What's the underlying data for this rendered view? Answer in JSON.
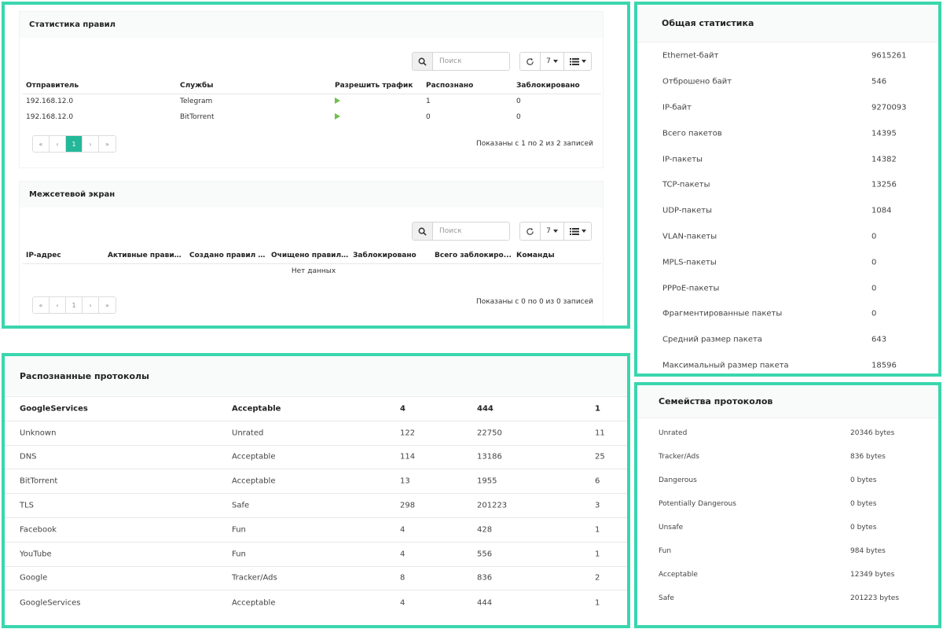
{
  "rules_stats": {
    "title": "Статистика правил",
    "search_placeholder": "Поиск",
    "page_size": "7",
    "columns": [
      "Отправитель",
      "Службы",
      "Разрешить трафик",
      "Распознано",
      "Заблокировано"
    ],
    "rows": [
      {
        "sender": "192.168.12.0",
        "service": "Telegram",
        "recognized": "1",
        "blocked": "0"
      },
      {
        "sender": "192.168.12.0",
        "service": "BitTorrent",
        "recognized": "0",
        "blocked": "0"
      }
    ],
    "pager": {
      "first": "«",
      "prev": "‹",
      "page": "1",
      "next": "›",
      "last": "»"
    },
    "info": "Показаны с 1 по 2 из 2 записей"
  },
  "firewall": {
    "title": "Межсетевой экран",
    "search_placeholder": "Поиск",
    "page_size": "7",
    "columns": [
      "IP-адрес",
      "Активные правил...",
      "Создано правил PF",
      "Очищено правил ...",
      "Заблокировано",
      "Всего заблокиро...",
      "Команды"
    ],
    "empty": "Нет данных",
    "pager": {
      "first": "«",
      "prev": "‹",
      "page": "1",
      "next": "›",
      "last": "»"
    },
    "info": "Показаны с 0 по 0 из 0 записей"
  },
  "protocols": {
    "title": "Распознанные протоколы",
    "rows": [
      {
        "name": "GoogleServices",
        "category": "Acceptable",
        "a": "4",
        "b": "444",
        "c": "1"
      },
      {
        "name": "Unknown",
        "category": "Unrated",
        "a": "122",
        "b": "22750",
        "c": "11"
      },
      {
        "name": "DNS",
        "category": "Acceptable",
        "a": "114",
        "b": "13186",
        "c": "25"
      },
      {
        "name": "BitTorrent",
        "category": "Acceptable",
        "a": "13",
        "b": "1955",
        "c": "6"
      },
      {
        "name": "TLS",
        "category": "Safe",
        "a": "298",
        "b": "201223",
        "c": "3"
      },
      {
        "name": "Facebook",
        "category": "Fun",
        "a": "4",
        "b": "428",
        "c": "1"
      },
      {
        "name": "YouTube",
        "category": "Fun",
        "a": "4",
        "b": "556",
        "c": "1"
      },
      {
        "name": "Google",
        "category": "Tracker/Ads",
        "a": "8",
        "b": "836",
        "c": "2"
      },
      {
        "name": "GoogleServices",
        "category": "Acceptable",
        "a": "4",
        "b": "444",
        "c": "1"
      }
    ]
  },
  "general_stats": {
    "title": "Общая статистика",
    "rows": [
      {
        "label": "Ethernet-байт",
        "value": "9615261"
      },
      {
        "label": "Отброшено байт",
        "value": "546"
      },
      {
        "label": "IP-байт",
        "value": "9270093"
      },
      {
        "label": "Всего пакетов",
        "value": "14395"
      },
      {
        "label": "IP-пакеты",
        "value": "14382"
      },
      {
        "label": "TCP-пакеты",
        "value": "13256"
      },
      {
        "label": "UDP-пакеты",
        "value": "1084"
      },
      {
        "label": "VLAN-пакеты",
        "value": "0"
      },
      {
        "label": "MPLS-пакеты",
        "value": "0"
      },
      {
        "label": "PPPoE-пакеты",
        "value": "0"
      },
      {
        "label": "Фрагментированные пакеты",
        "value": "0"
      },
      {
        "label": "Средний размер пакета",
        "value": "643"
      },
      {
        "label": "Максимальный размер пакета",
        "value": "18596"
      }
    ]
  },
  "families": {
    "title": "Семейства протоколов",
    "rows": [
      {
        "label": "Unrated",
        "value": "20346 bytes"
      },
      {
        "label": "Tracker/Ads",
        "value": "836 bytes"
      },
      {
        "label": "Dangerous",
        "value": "0 bytes"
      },
      {
        "label": "Potentially Dangerous",
        "value": "0 bytes"
      },
      {
        "label": "Unsafe",
        "value": "0 bytes"
      },
      {
        "label": "Fun",
        "value": "984 bytes"
      },
      {
        "label": "Acceptable",
        "value": "12349 bytes"
      },
      {
        "label": "Safe",
        "value": "201223 bytes"
      }
    ]
  },
  "colors": {
    "frame": "#3ad6ae",
    "active_page": "#24b89a",
    "allow_icon": "#6cc04a"
  }
}
